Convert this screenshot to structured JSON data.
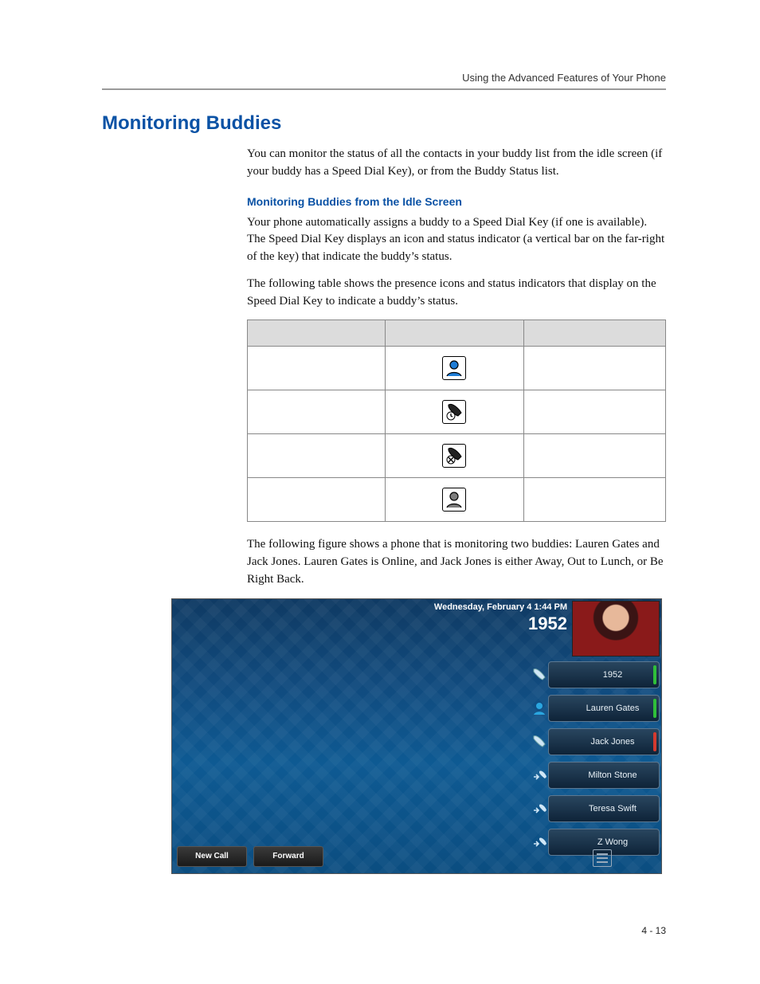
{
  "running_head": "Using the Advanced Features of Your Phone",
  "h1": "Monitoring Buddies",
  "p1": "You can monitor the status of all the contacts in your buddy list from the idle screen (if your buddy has a Speed Dial Key), or from the Buddy Status list.",
  "h3a": "Monitoring Buddies from the Idle Screen",
  "p2": "Your phone automatically assigns a buddy to a Speed Dial Key (if one is available). The Speed Dial Key displays an icon and status indicator (a vertical bar on the far-right of the key) that indicate the buddy’s status.",
  "p3": "The following table shows the presence icons and status indicators that display on the Speed Dial Key to indicate a buddy’s status.",
  "table_rows": [
    {
      "icon": "person-online"
    },
    {
      "icon": "handset-away"
    },
    {
      "icon": "handset-dnd"
    },
    {
      "icon": "person-offline"
    }
  ],
  "p4": "The following figure shows a phone that is monitoring two buddies: Lauren Gates and Jack Jones. Lauren Gates is Online, and Jack Jones is either Away, Out to Lunch, or Be Right Back.",
  "figure": {
    "datetime": "Wednesday, February 4  1:44 PM",
    "extension": "1952",
    "keys": [
      {
        "label": "1952",
        "icon": "handset",
        "bar": "green"
      },
      {
        "label": "Lauren Gates",
        "icon": "person",
        "bar": "green"
      },
      {
        "label": "Jack Jones",
        "icon": "handset",
        "bar": "red"
      },
      {
        "label": "Milton Stone",
        "icon": "speeddial",
        "bar": null
      },
      {
        "label": "Teresa Swift",
        "icon": "speeddial",
        "bar": null
      },
      {
        "label": "Z Wong",
        "icon": "speeddial",
        "bar": null
      }
    ],
    "softkeys": [
      "New Call",
      "Forward"
    ]
  },
  "page_number": "4 - 13"
}
